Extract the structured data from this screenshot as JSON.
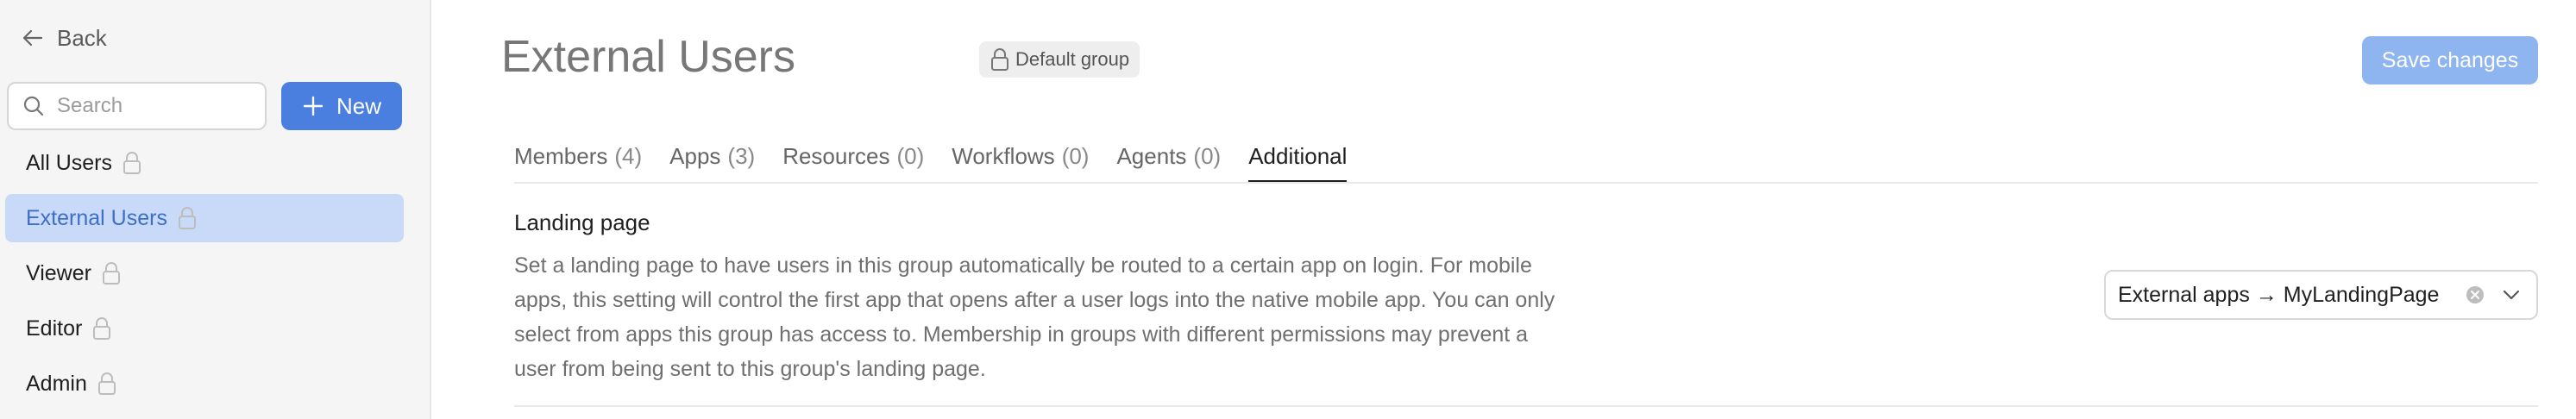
{
  "sidebar": {
    "back_label": "Back",
    "search_placeholder": "Search",
    "new_label": "New",
    "groups": [
      {
        "label": "All Users",
        "active": false
      },
      {
        "label": "External Users",
        "active": true
      },
      {
        "label": "Viewer",
        "active": false
      },
      {
        "label": "Editor",
        "active": false
      },
      {
        "label": "Admin",
        "active": false
      }
    ]
  },
  "header": {
    "title": "External Users",
    "badge_label": "Default group",
    "save_label": "Save changes"
  },
  "tabs": [
    {
      "label": "Members",
      "count": "(4)"
    },
    {
      "label": "Apps",
      "count": "(3)"
    },
    {
      "label": "Resources",
      "count": "(0)"
    },
    {
      "label": "Workflows",
      "count": "(0)"
    },
    {
      "label": "Agents",
      "count": "(0)"
    },
    {
      "label": "Additional",
      "count": ""
    }
  ],
  "landing": {
    "title": "Landing page",
    "description": "Set a landing page to have users in this group automatically be routed to a certain app on login. For mobile apps, this setting will control the first app that opens after a user logs into the native mobile app. You can only select from apps this group has access to. Membership in groups with different permissions may prevent a user from being sent to this group's landing page.",
    "select_value": "External apps → MyLandingPage"
  },
  "colors": {
    "accent": "#4a7fe0",
    "save_disabled": "#8fb5f0",
    "active_item_bg": "#c8daf7",
    "active_item_text": "#3d6fc9"
  },
  "icons": {
    "back": "arrow-left-icon",
    "search": "search-icon",
    "new": "plus-icon",
    "lock": "lock-icon",
    "clear": "clear-circle-icon",
    "dropdown": "chevron-down-icon"
  }
}
